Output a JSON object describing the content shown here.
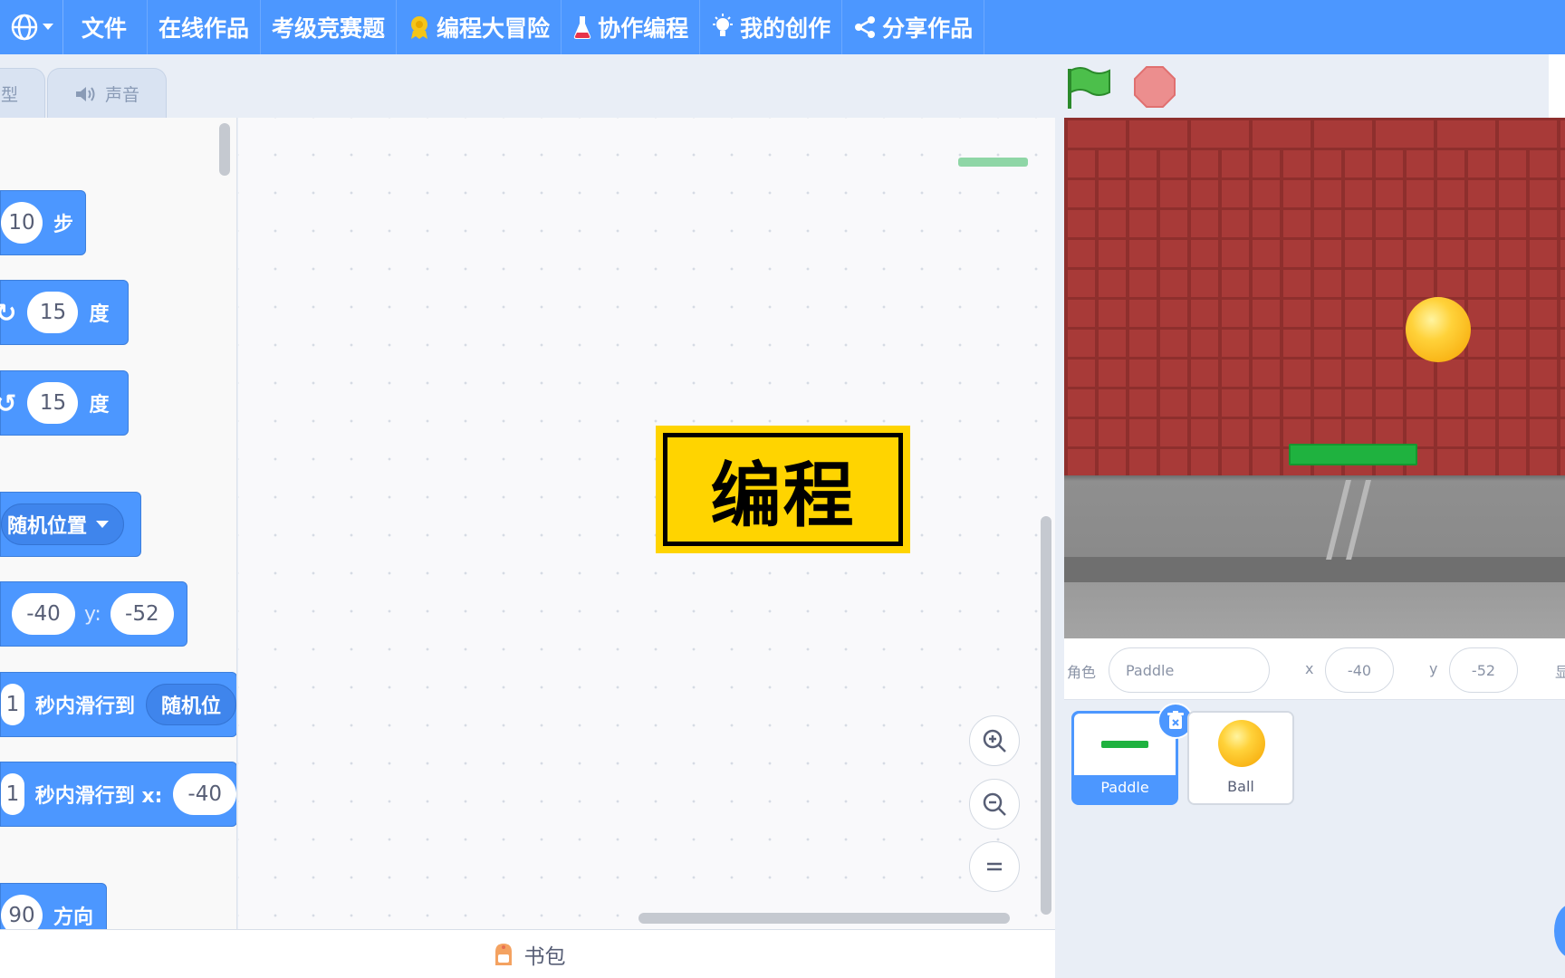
{
  "menubar": {
    "items": [
      {
        "label": "文件",
        "icon": ""
      },
      {
        "label": "在线作品",
        "icon": ""
      },
      {
        "label": "考级竞赛题",
        "icon": ""
      },
      {
        "label": "编程大冒险",
        "icon": "medal-icon"
      },
      {
        "label": "协作编程",
        "icon": "flask-icon"
      },
      {
        "label": "我的创作",
        "icon": "lightbulb-icon"
      },
      {
        "label": "分享作品",
        "icon": "share-icon"
      }
    ],
    "color": "#4c97ff"
  },
  "tabs": {
    "shape_label": "型",
    "sound_label": "声音"
  },
  "palette": {
    "move": {
      "steps": "10",
      "suffix": "步"
    },
    "turn_right": {
      "degrees": "15",
      "suffix": "度"
    },
    "turn_left": {
      "degrees": "15",
      "suffix": "度"
    },
    "goto": {
      "target": "随机位置"
    },
    "goto_xy": {
      "x": "-40",
      "y_label": "y:",
      "y": "-52"
    },
    "glide": {
      "secs": "1",
      "text": "秒内滑行到",
      "target": "随机位"
    },
    "glide_xy": {
      "secs": "1",
      "text": "秒内滑行到 x:",
      "x": "-40"
    },
    "direction": {
      "value": "90",
      "suffix": "方向"
    },
    "block_color": "#4c97ff"
  },
  "code_area": {
    "overlay_title": "编程"
  },
  "backpack": {
    "label": "书包"
  },
  "sprite_info": {
    "sprite_label": "角色",
    "sprite_name": "Paddle",
    "x_label": "x",
    "x_value": "-40",
    "y_label": "y",
    "y_value": "-52",
    "show_label": "显"
  },
  "sprites": [
    {
      "name": "Paddle",
      "selected": true
    },
    {
      "name": "Ball",
      "selected": false
    }
  ]
}
